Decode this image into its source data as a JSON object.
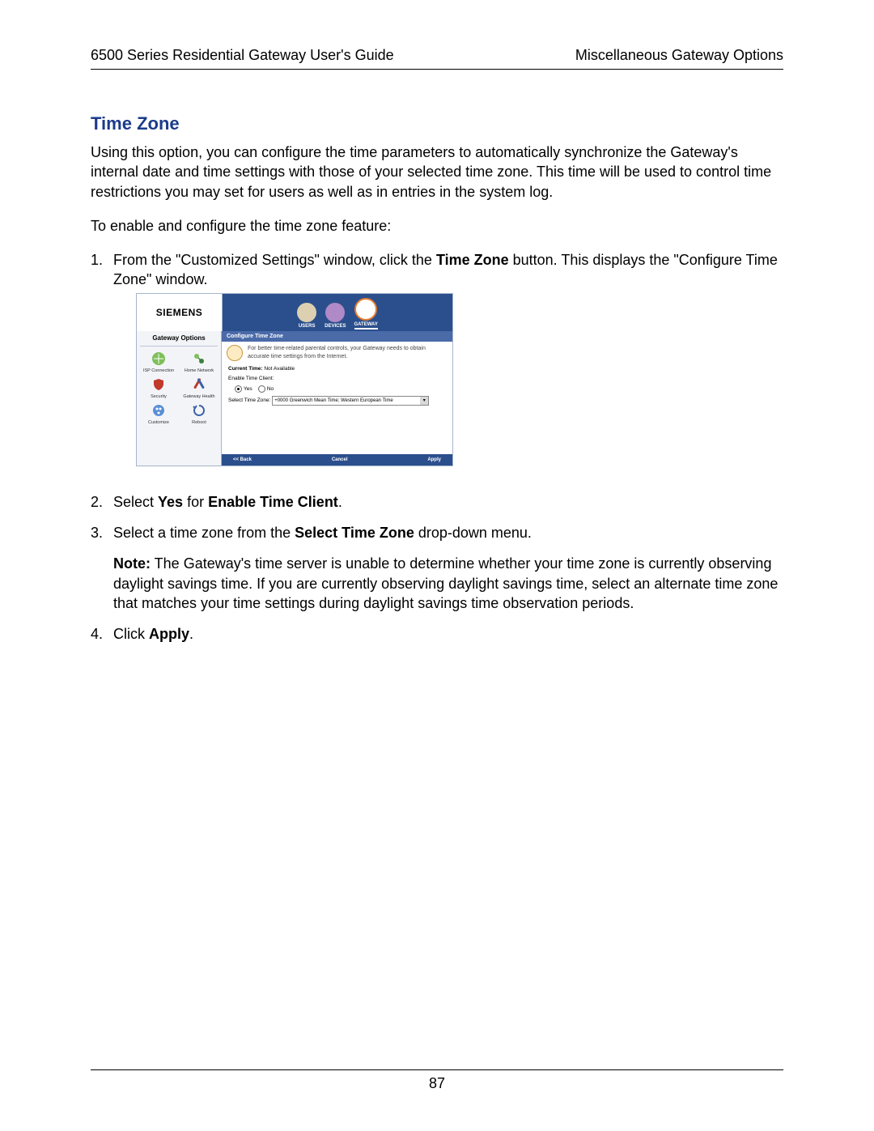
{
  "header": {
    "left": "6500 Series Residential Gateway User's Guide",
    "right": "Miscellaneous Gateway Options"
  },
  "section_title": "Time Zone",
  "intro_para": "Using this option, you can configure the time parameters to automatically synchronize the Gateway's internal date and time settings with those of your selected time zone. This time will be used to control time restrictions you may set for users as well as in entries in the system log.",
  "lead_in": "To enable and configure the time zone feature:",
  "steps": {
    "s1_pre": "From the \"Customized Settings\" window, click the ",
    "s1_bold": "Time Zone",
    "s1_post": " button. This displays the \"Configure Time Zone\" window.",
    "s2_pre": "Select ",
    "s2_b1": "Yes",
    "s2_mid": "  for ",
    "s2_b2": "Enable Time Client",
    "s2_post": ".",
    "s3_pre": "Select a time zone from the ",
    "s3_bold": "Select Time Zone",
    "s3_post": " drop-down menu.",
    "s3_note_label": "Note:",
    "s3_note_body": " The Gateway's time server is unable to determine whether your time zone is currently observing daylight savings time. If you are currently observing daylight savings time, select an alternate time zone that matches your time settings during daylight savings time observation periods.",
    "s4_pre": "Click ",
    "s4_bold": "Apply",
    "s4_post": "."
  },
  "screenshot": {
    "brand": "SIEMENS",
    "topnav": {
      "users": "USERS",
      "devices": "DEVICES",
      "gateway": "GATEWAY"
    },
    "sidebar_title": "Gateway Options",
    "sidebar": {
      "isp": "ISP Connection",
      "home": "Home Network",
      "security": "Security",
      "health": "Gateway Health",
      "customize": "Customize",
      "reboot": "Reboot"
    },
    "pane_title": "Configure Time Zone",
    "info_text": "For better time-related parental controls, your Gateway needs to obtain accurate time settings from the Internet.",
    "current_time_label": "Current Time:",
    "current_time_value": "Not Available",
    "enable_label": "Enable Time Client:",
    "radio_yes": "Yes",
    "radio_no": "No",
    "tz_label": "Select Time Zone:",
    "tz_value": "+0000 Greenwich Mean Time; Western European Time",
    "btn_back": "<< Back",
    "btn_cancel": "Cancel",
    "btn_apply": "Apply"
  },
  "page_number": "87"
}
